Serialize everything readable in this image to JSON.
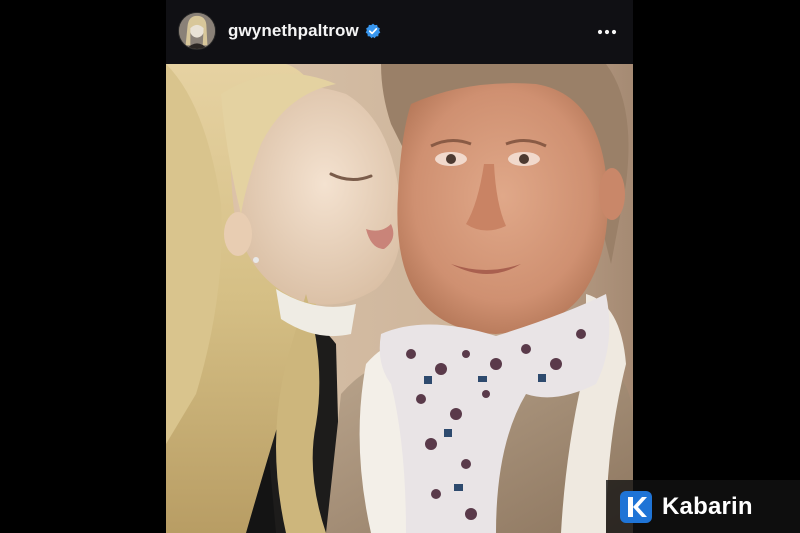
{
  "post": {
    "username": "gwynethpaltrow",
    "verified": true,
    "icons": {
      "avatar": "profile-avatar",
      "verified": "verified-badge-icon",
      "more": "more-options-icon"
    },
    "colors": {
      "header_bg": "#101014",
      "verified_blue": "#3897f0",
      "page_bg": "#000000"
    }
  },
  "watermark": {
    "brand": "Kabarin",
    "logo_letter": "K",
    "brand_color": "#1f74d6"
  }
}
